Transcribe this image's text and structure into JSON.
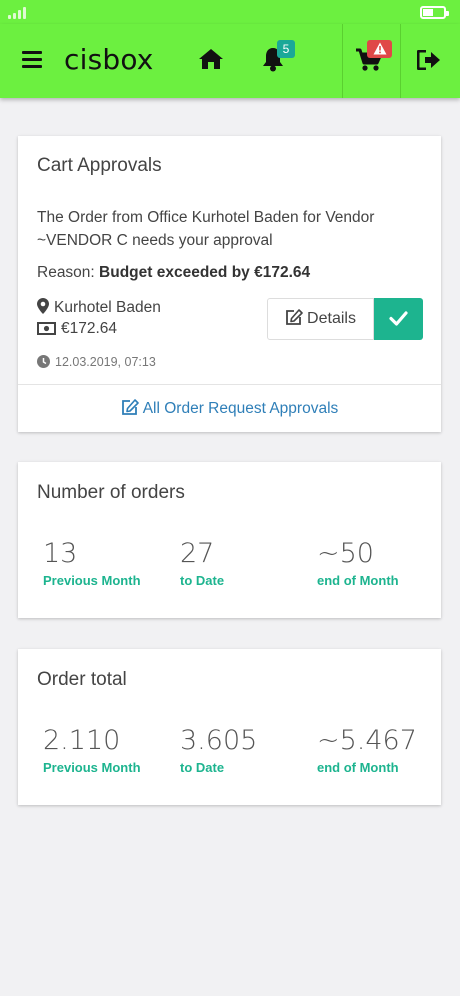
{
  "app": {
    "brand": "cisbox"
  },
  "navbar": {
    "notifications_badge": "5",
    "cart_badge": "!"
  },
  "approvals": {
    "title": "Cart Approvals",
    "order_text": "The Order from Office Kurhotel Baden for Vendor ~VENDOR C needs your approval",
    "reason_label": "Reason:",
    "reason_value": "Budget exceeded by €172.64",
    "location": "Kurhotel Baden",
    "amount": "€172.64",
    "timestamp": "12.03.2019, 07:13",
    "details_label": "Details",
    "all_link": "All Order Request Approvals"
  },
  "orders": {
    "title": "Number of orders",
    "stats": [
      {
        "value": "13",
        "label": "Previous Month"
      },
      {
        "value": "27",
        "label": "to Date"
      },
      {
        "value": "~50",
        "label": "end of Month"
      }
    ]
  },
  "total": {
    "title": "Order total",
    "stats": [
      {
        "value": "2.110",
        "label": "Previous Month"
      },
      {
        "value": "3.605",
        "label": "to Date"
      },
      {
        "value": "~5.467",
        "label": "end of Month"
      }
    ]
  },
  "colors": {
    "brand_green": "#6cf040",
    "accent_teal": "#1db48f",
    "link_blue": "#2f7fb8",
    "alert_red": "#e04848"
  },
  "icons": [
    "menu-icon",
    "home-icon",
    "bell-icon",
    "cart-icon",
    "warning-icon",
    "logout-icon",
    "map-marker-icon",
    "money-icon",
    "clock-icon",
    "edit-icon",
    "check-icon"
  ]
}
